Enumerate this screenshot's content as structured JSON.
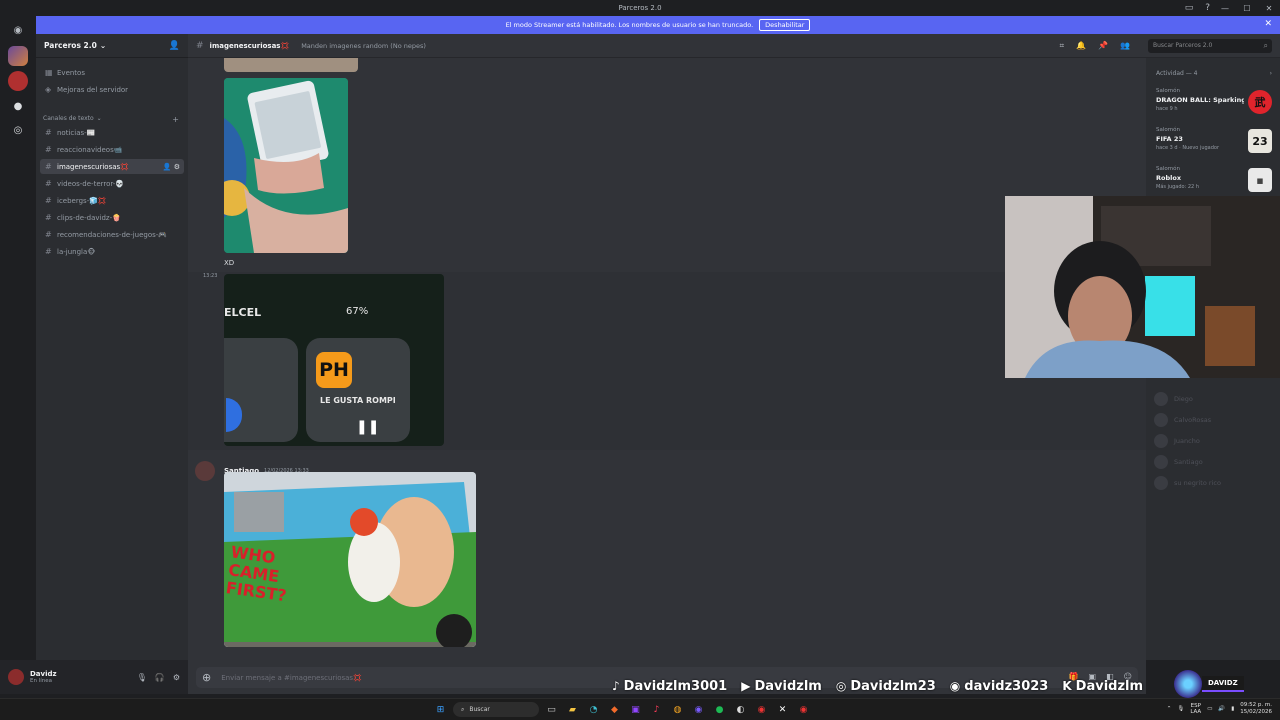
{
  "window": {
    "title": "Parceros 2.0",
    "min": "—",
    "max": "☐",
    "close": "✕"
  },
  "banner": {
    "text": "El modo Streamer está habilitado. Los nombres de usuario se han truncado.",
    "button": "Deshabilitar"
  },
  "server": {
    "name": "Parceros 2.0",
    "top_items": [
      {
        "icon": "calendar-icon",
        "label": "Eventos"
      },
      {
        "icon": "boost-icon",
        "label": "Mejoras del servidor"
      }
    ],
    "category": "Canales de texto",
    "channels": [
      {
        "label": "noticias-📰"
      },
      {
        "label": "reaccionavideos📹"
      },
      {
        "label": "imagenescuriosas💢",
        "active": true
      },
      {
        "label": "videos-de-terror-💀"
      },
      {
        "label": "icebergs-🧊💢"
      },
      {
        "label": "clips-de-davidz-🍿"
      },
      {
        "label": "recomendaciones-de-juegos-🎮"
      },
      {
        "label": "la-jungla🐵"
      }
    ]
  },
  "user": {
    "name": "Davidz",
    "status": "En línea"
  },
  "channel": {
    "name": "imagenescuriosas💢",
    "topic": "Manden imagenes random (No nepes)",
    "search_placeholder": "Buscar Parceros 2.0"
  },
  "messages": {
    "caption": "XD",
    "timestamp": "13:23",
    "image3_text": {
      "carrier": "ELCEL",
      "battery": "67%",
      "app_label": "PH",
      "song": "LE GUSTA ROMPI"
    },
    "author": "Santiago",
    "date": "12/02/2026 13:33",
    "van_text": "WHO CAME FIRST?"
  },
  "composer": {
    "placeholder": "Enviar mensaje a #imagenescuriosas💢"
  },
  "activity": {
    "title": "Actividad — 4",
    "cards": [
      {
        "who": "Salomón",
        "game": "DRAGON BALL: Sparking! ...",
        "meta": "hace 9 h",
        "icon_text": "武",
        "color": "#e0242c"
      },
      {
        "who": "Salomón",
        "game": "FIFA 23",
        "meta": "hace 3 d  ·  Nuevo jugador",
        "icon_text": "23",
        "color": "#e8e6df"
      },
      {
        "who": "Salomón",
        "game": "Roblox",
        "meta": "Más jugado: 22 h",
        "icon_text": "▪",
        "color": "#2b2d31"
      }
    ],
    "members": [
      "Diego",
      "CalvoRosas",
      "Juancho",
      "Santiago",
      "su negrito rico"
    ]
  },
  "overlay": {
    "tiktok": "Davidzlm3001",
    "youtube": "Davidzlm",
    "instagram": "Davidzlm23",
    "discord": "davidz3023",
    "kick": "Davidzlm",
    "brand": "DAVIDZ"
  },
  "taskbar": {
    "search": "Buscar",
    "lang": "ESP",
    "region": "LAA",
    "time": "09:52 p. m.",
    "date": "15/02/2026"
  }
}
